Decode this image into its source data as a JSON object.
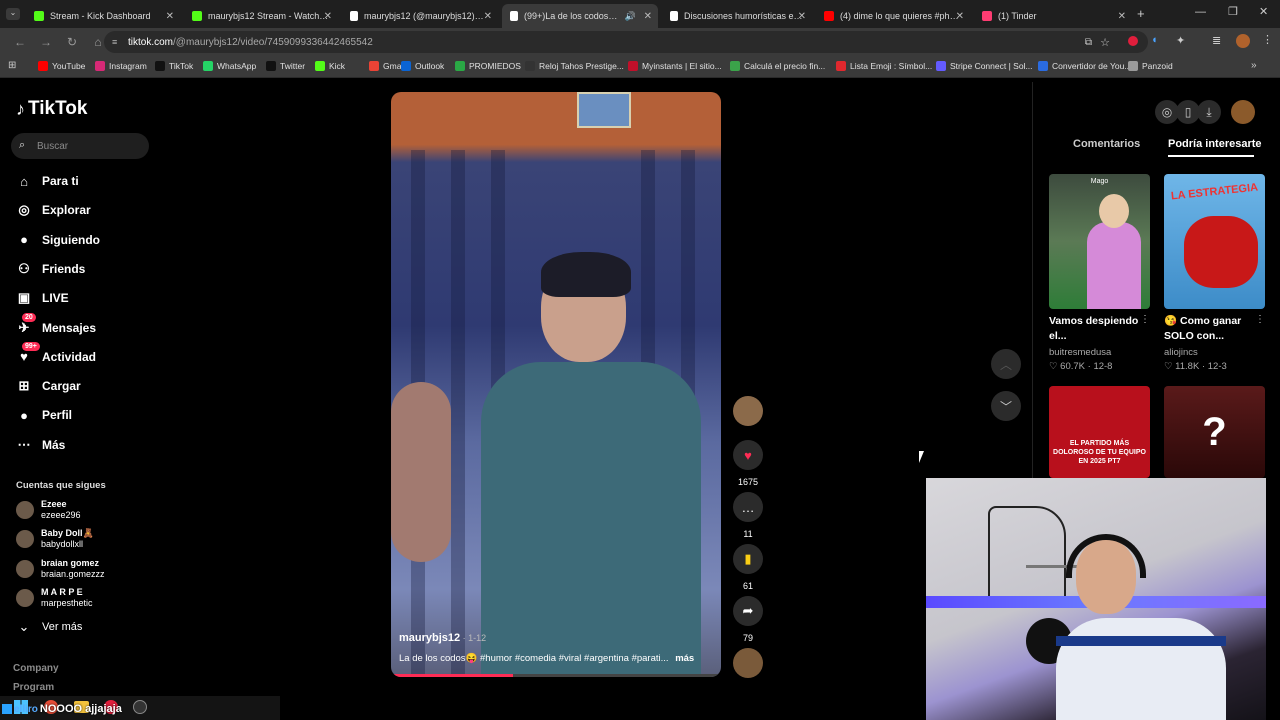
{
  "browser": {
    "tabs": [
      {
        "title": "Stream - Kick Dashboard",
        "color": "#53fc18"
      },
      {
        "title": "maurybjs12 Stream - Watch Live",
        "color": "#53fc18"
      },
      {
        "title": "maurybjs12 (@maurybjs12) | TikTok",
        "color": "#ffffff"
      },
      {
        "title": "(99+)La de los codos😝 #hu",
        "color": "#ffffff"
      },
      {
        "title": "Discusiones humorísticas entre",
        "color": "#ffffff"
      },
      {
        "title": "(4) dime lo que quieres #phonk",
        "color": "#ff0000"
      },
      {
        "title": "(1) Tinder",
        "color": "#fe3c72"
      }
    ],
    "url_host": "tiktok.com",
    "url_path": "/@maurybjs12/video/7459099336442465542",
    "bookmarks": [
      {
        "label": "YouTube",
        "color": "#ff0000"
      },
      {
        "label": "Instagram",
        "color": "#d62976"
      },
      {
        "label": "TikTok",
        "color": "#111111"
      },
      {
        "label": "WhatsApp",
        "color": "#25d366"
      },
      {
        "label": "Twitter",
        "color": "#111111"
      },
      {
        "label": "Kick",
        "color": "#53fc18"
      },
      {
        "label": "Gmail",
        "color": "#ea4335"
      },
      {
        "label": "Outlook",
        "color": "#0a64d4"
      },
      {
        "label": "PROMIEDOS",
        "color": "#2aa845"
      },
      {
        "label": "Reloj Tahos Prestige...",
        "color": "#333333"
      },
      {
        "label": "Myinstants | El sitio...",
        "color": "#c0102a"
      },
      {
        "label": "Calculá el precio fin...",
        "color": "#3ba34a"
      },
      {
        "label": "Lista Emoji : Símbol...",
        "color": "#e0282e"
      },
      {
        "label": "Stripe Connect | Sol...",
        "color": "#635bff"
      },
      {
        "label": "Convertidor de You...",
        "color": "#2a6be0"
      },
      {
        "label": "Panzoid",
        "color": "#9a9a9a"
      }
    ]
  },
  "sidebar": {
    "logo": "TikTok",
    "search_placeholder": "Buscar",
    "nav": [
      {
        "label": "Para ti",
        "icon": "home-icon"
      },
      {
        "label": "Explorar",
        "icon": "compass-icon"
      },
      {
        "label": "Siguiendo",
        "icon": "following-icon"
      },
      {
        "label": "Friends",
        "icon": "friends-icon"
      },
      {
        "label": "LIVE",
        "icon": "live-icon"
      },
      {
        "label": "Mensajes",
        "icon": "messages-icon",
        "badge": "20"
      },
      {
        "label": "Actividad",
        "icon": "activity-icon",
        "badge": "99+"
      },
      {
        "label": "Cargar",
        "icon": "upload-icon"
      },
      {
        "label": "Perfil",
        "icon": "profile-icon"
      },
      {
        "label": "Más",
        "icon": "more-icon"
      }
    ],
    "following_title": "Cuentas que sigues",
    "following": [
      {
        "name": "Ezeee",
        "handle": "ezeee296"
      },
      {
        "name": "Baby Doll🧸",
        "handle": "babydollxll"
      },
      {
        "name": "braian gomez",
        "handle": "braian.gomezzz"
      },
      {
        "name": "M A R P E",
        "handle": "marpesthetic"
      }
    ],
    "see_more": "Ver más",
    "footer": [
      "Company",
      "Program"
    ]
  },
  "video": {
    "author": "maurybjs12",
    "date": "1-12",
    "description": "La de los codos😝 #humor #comedia #viral #argentina #parati...",
    "more": "más",
    "progress": 0.37,
    "likes": "1675",
    "comments": "11",
    "saves": "61",
    "shares": "79"
  },
  "right": {
    "tabs": [
      "Comentarios",
      "Podría interesarte"
    ],
    "suggestions": [
      {
        "thumb_text": "Mago",
        "title": "Vamos despiendo el...",
        "author": "buitresmedusa",
        "views": "60.7K",
        "date": "12-8"
      },
      {
        "thumb_text": "LA ESTRATEGIA",
        "title": "😘 Como ganar SOLO con...",
        "author": "aliojincs",
        "views": "11.8K",
        "date": "12-3"
      },
      {
        "thumb_text": "EL PARTIDO MÁS DOLOROSO DE TU EQUIPO EN 2025 PT7",
        "title": "",
        "author": "",
        "views": "",
        "date": ""
      },
      {
        "thumb_text": "?",
        "title": "",
        "author": "",
        "views": "",
        "date": ""
      }
    ]
  },
  "overlay": {
    "chat_text": "NOOOO ajjajaja",
    "chat_user": "elliro"
  }
}
